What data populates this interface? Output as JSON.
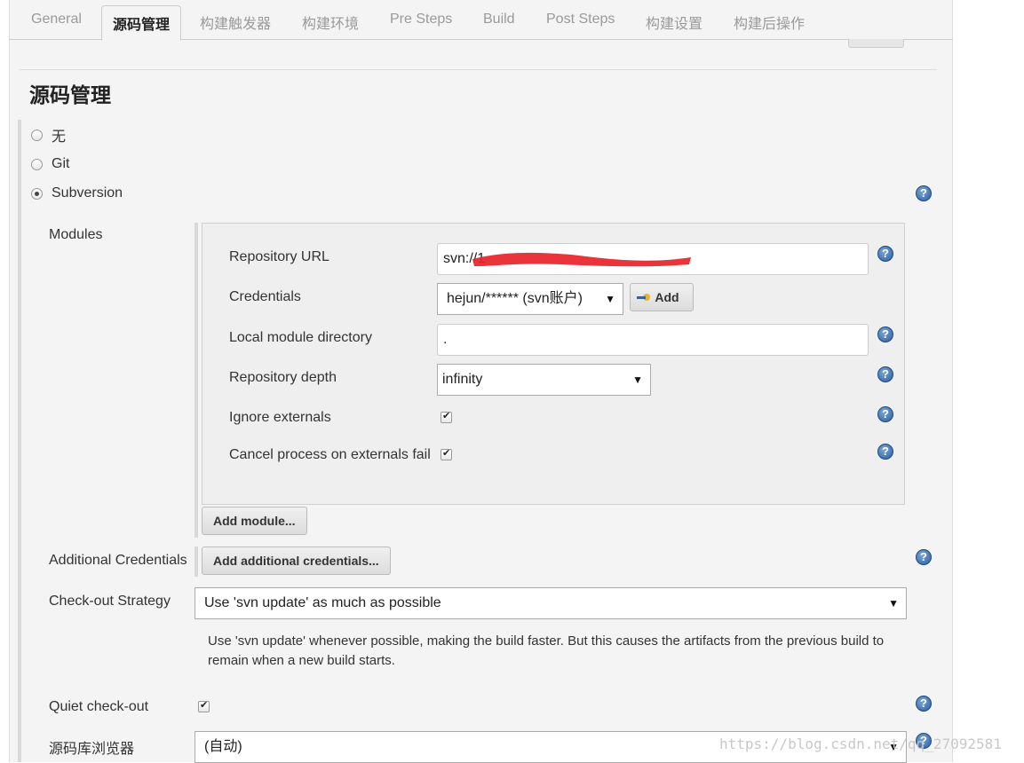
{
  "tabs": [
    {
      "label": "General"
    },
    {
      "label": "源码管理"
    },
    {
      "label": "构建触发器"
    },
    {
      "label": "构建环境"
    },
    {
      "label": "Pre Steps"
    },
    {
      "label": "Build"
    },
    {
      "label": "Post Steps"
    },
    {
      "label": "构建设置"
    },
    {
      "label": "构建后操作"
    }
  ],
  "section_title": "源码管理",
  "scm_options": [
    {
      "label": "无",
      "selected": false
    },
    {
      "label": "Git",
      "selected": false
    },
    {
      "label": "Subversion",
      "selected": true
    }
  ],
  "modules": {
    "label": "Modules",
    "repository_url_label": "Repository URL",
    "repository_url_value": "svn://1",
    "credentials_label": "Credentials",
    "credentials_value": "hejun/****** (svn账户)",
    "add_button": "Add",
    "local_module_label": "Local module directory",
    "local_module_value": ".",
    "depth_label": "Repository depth",
    "depth_value": "infinity",
    "ignore_externals_label": "Ignore externals",
    "ignore_externals_checked": true,
    "cancel_externals_label": "Cancel process on externals fail",
    "cancel_externals_checked": true,
    "add_module_button": "Add module..."
  },
  "additional_credentials": {
    "label": "Additional Credentials",
    "button": "Add additional credentials..."
  },
  "checkout_strategy": {
    "label": "Check-out Strategy",
    "value": "Use 'svn update' as much as possible",
    "description": "Use 'svn update' whenever possible, making the build faster. But this causes the artifacts from the previous build to remain when a new build starts."
  },
  "quiet_checkout": {
    "label": "Quiet check-out",
    "checked": true
  },
  "repo_browser": {
    "label": "源码库浏览器",
    "value": "(自动)"
  },
  "help_glyph": "?",
  "dropdown_glyph": "▼",
  "watermark": "https://blog.csdn.net/qq_27092581",
  "colors": {
    "help_icon": "#2b5d9e",
    "redaction": "#e8232a"
  }
}
